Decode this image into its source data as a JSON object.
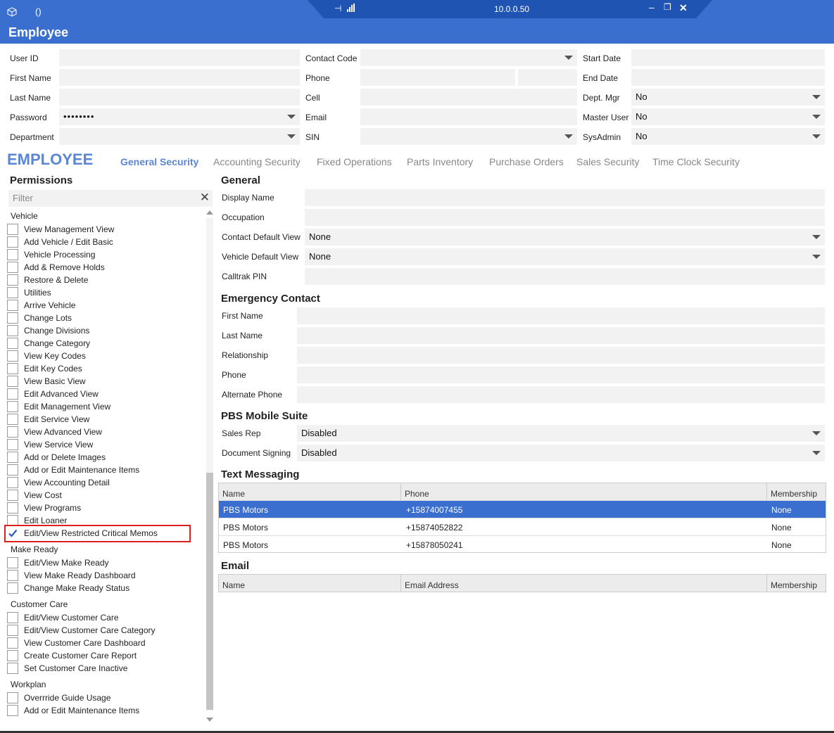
{
  "window": {
    "title": "Employee",
    "remote_ip": "10.0.0.50",
    "icon_text": "()"
  },
  "header_fields": {
    "user_id": {
      "label": "User ID",
      "value": ""
    },
    "first_name": {
      "label": "First Name",
      "value": ""
    },
    "last_name": {
      "label": "Last Name",
      "value": ""
    },
    "password": {
      "label": "Password",
      "value": "••••••••"
    },
    "department": {
      "label": "Department",
      "value": ""
    },
    "contact_code": {
      "label": "Contact Code",
      "value": ""
    },
    "phone": {
      "label": "Phone",
      "value": ""
    },
    "cell": {
      "label": "Cell",
      "value": ""
    },
    "email": {
      "label": "Email",
      "value": ""
    },
    "sin": {
      "label": "SIN",
      "value": ""
    },
    "start_date": {
      "label": "Start Date",
      "value": ""
    },
    "end_date": {
      "label": "End Date",
      "value": ""
    },
    "dept_mgr": {
      "label": "Dept. Mgr",
      "value": "No"
    },
    "master_user": {
      "label": "Master User",
      "value": "No"
    },
    "sysadmin": {
      "label": "SysAdmin",
      "value": "No"
    }
  },
  "section_title": "EMPLOYEE",
  "tabs": [
    "General Security",
    "Accounting Security",
    "Fixed Operations",
    "Parts Inventory",
    "Purchase Orders",
    "Sales Security",
    "Time Clock Security"
  ],
  "permissions": {
    "title": "Permissions",
    "filter_placeholder": "Filter",
    "groups": [
      {
        "name": "Vehicle",
        "items": [
          {
            "label": "View Management View",
            "checked": false
          },
          {
            "label": "Add Vehicle / Edit Basic",
            "checked": false
          },
          {
            "label": "Vehicle Processing",
            "checked": false
          },
          {
            "label": "Add & Remove Holds",
            "checked": false
          },
          {
            "label": "Restore & Delete",
            "checked": false
          },
          {
            "label": "Utilities",
            "checked": false
          },
          {
            "label": "Arrive Vehicle",
            "checked": false
          },
          {
            "label": "Change Lots",
            "checked": false
          },
          {
            "label": "Change Divisions",
            "checked": false
          },
          {
            "label": "Change Category",
            "checked": false
          },
          {
            "label": "View Key Codes",
            "checked": false
          },
          {
            "label": "Edit Key Codes",
            "checked": false
          },
          {
            "label": "View Basic View",
            "checked": false
          },
          {
            "label": "Edit Advanced View",
            "checked": false
          },
          {
            "label": "Edit Management View",
            "checked": false
          },
          {
            "label": "Edit Service View",
            "checked": false
          },
          {
            "label": "View Advanced View",
            "checked": false
          },
          {
            "label": "View Service View",
            "checked": false
          },
          {
            "label": "Add or Delete Images",
            "checked": false
          },
          {
            "label": "Add or Edit Maintenance Items",
            "checked": false
          },
          {
            "label": "View Accounting Detail",
            "checked": false
          },
          {
            "label": "View Cost",
            "checked": false
          },
          {
            "label": "View Programs",
            "checked": false
          },
          {
            "label": "Edit Loaner",
            "checked": false
          },
          {
            "label": "Edit/View Restricted Critical Memos",
            "checked": true
          }
        ]
      },
      {
        "name": "Make Ready",
        "items": [
          {
            "label": "Edit/View Make Ready",
            "checked": false
          },
          {
            "label": "View Make Ready Dashboard",
            "checked": false
          },
          {
            "label": "Change Make Ready Status",
            "checked": false
          }
        ]
      },
      {
        "name": "Customer Care",
        "items": [
          {
            "label": "Edit/View Customer Care",
            "checked": false
          },
          {
            "label": "Edit/View Customer Care Category",
            "checked": false
          },
          {
            "label": "View Customer Care Dashboard",
            "checked": false
          },
          {
            "label": "Create Customer Care Report",
            "checked": false
          },
          {
            "label": "Set Customer Care Inactive",
            "checked": false
          }
        ]
      },
      {
        "name": "Workplan",
        "items": [
          {
            "label": "Overrride Guide Usage",
            "checked": false
          },
          {
            "label": "Add or Edit Maintenance Items",
            "checked": false
          }
        ]
      }
    ]
  },
  "general": {
    "title": "General",
    "display_name": {
      "label": "Display Name",
      "value": ""
    },
    "occupation": {
      "label": "Occupation",
      "value": ""
    },
    "contact_default_view": {
      "label": "Contact Default View",
      "value": "None"
    },
    "vehicle_default_view": {
      "label": "Vehicle Default View",
      "value": "None"
    },
    "calltrak_pin": {
      "label": "Calltrak PIN",
      "value": ""
    }
  },
  "emergency": {
    "title": "Emergency Contact",
    "first_name": {
      "label": "First Name",
      "value": ""
    },
    "last_name": {
      "label": "Last Name",
      "value": ""
    },
    "relationship": {
      "label": "Relationship",
      "value": ""
    },
    "phone": {
      "label": "Phone",
      "value": ""
    },
    "alternate_phone": {
      "label": "Alternate Phone",
      "value": ""
    }
  },
  "mobile": {
    "title": "PBS Mobile Suite",
    "sales_rep": {
      "label": "Sales Rep",
      "value": "Disabled"
    },
    "document_signing": {
      "label": "Document Signing",
      "value": "Disabled"
    }
  },
  "text_messaging": {
    "title": "Text Messaging",
    "columns": [
      "Name",
      "Phone",
      "Membership"
    ],
    "rows": [
      {
        "name": "PBS Motors",
        "phone": "+15874007455",
        "membership": "None"
      },
      {
        "name": "PBS Motors",
        "phone": "+15874052822",
        "membership": "None"
      },
      {
        "name": "PBS Motors",
        "phone": "+15878050241",
        "membership": "None"
      }
    ]
  },
  "email_table": {
    "title": "Email",
    "columns": [
      "Name",
      "Email Address",
      "Membership"
    ]
  },
  "colors": {
    "titlebar": "#3b6fcf",
    "accent": "#3b6fcf",
    "highlight_box": "#e02020"
  }
}
